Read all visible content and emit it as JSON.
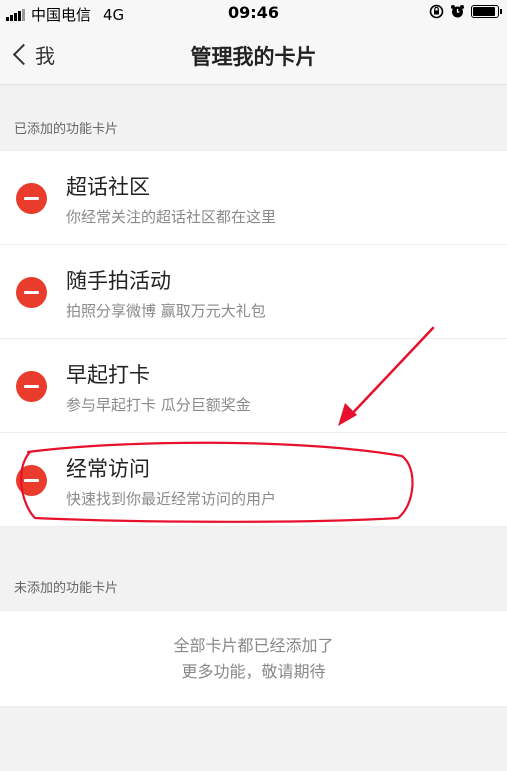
{
  "status_bar": {
    "carrier": "中国电信",
    "network": "4G",
    "time": "09:46",
    "battery_level": 0.92
  },
  "nav": {
    "back_label": "我",
    "title": "管理我的卡片"
  },
  "added_section": {
    "header": "已添加的功能卡片",
    "items": [
      {
        "title": "超话社区",
        "desc": "你经常关注的超话社区都在这里"
      },
      {
        "title": "随手拍活动",
        "desc": "拍照分享微博 赢取万元大礼包"
      },
      {
        "title": "早起打卡",
        "desc": "参与早起打卡 瓜分巨额奖金"
      },
      {
        "title": "经常访问",
        "desc": "快速找到你最近经常访问的用户"
      }
    ]
  },
  "not_added_section": {
    "header": "未添加的功能卡片",
    "empty_line1": "全部卡片都已经添加了",
    "empty_line2": "更多功能，敬请期待"
  },
  "colors": {
    "remove": "#e93c2c",
    "annotation": "#e8112d"
  },
  "icons": [
    "signal-icon",
    "lock-rotation-icon",
    "alarm-icon",
    "battery-icon",
    "chevron-left-icon",
    "remove-icon"
  ]
}
